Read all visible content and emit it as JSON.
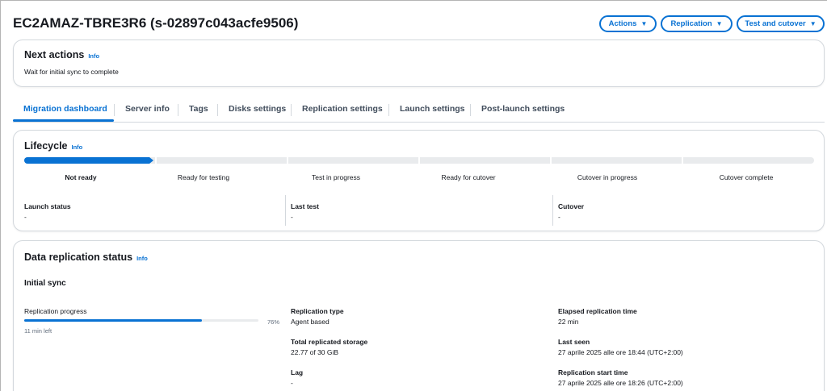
{
  "header": {
    "title": "EC2AMAZ-TBRE3R6 (s-02897c043acfe9506)",
    "actions_label": "Actions",
    "replication_label": "Replication",
    "test_cutover_label": "Test and cutover"
  },
  "next_actions": {
    "title": "Next actions",
    "info": "Info",
    "text": "Wait for initial sync to complete"
  },
  "tabs": [
    {
      "label": "Migration dashboard",
      "active": true
    },
    {
      "label": "Server info"
    },
    {
      "label": "Tags"
    },
    {
      "label": "Disks settings"
    },
    {
      "label": "Replication settings"
    },
    {
      "label": "Launch settings"
    },
    {
      "label": "Post-launch settings"
    }
  ],
  "lifecycle": {
    "title": "Lifecycle",
    "info": "Info",
    "current_stage_index": 0,
    "stages": [
      "Not ready",
      "Ready for testing",
      "Test in progress",
      "Ready for cutover",
      "Cutover in progress",
      "Cutover complete"
    ],
    "fields": [
      {
        "label": "Launch status",
        "value": "-"
      },
      {
        "label": "Last test",
        "value": "-"
      },
      {
        "label": "Cutover",
        "value": "-"
      }
    ]
  },
  "data_replication": {
    "title": "Data replication status",
    "info": "Info",
    "subtitle": "Initial sync",
    "progress_label": "Replication progress",
    "progress_percent": 76,
    "progress_text": "76%",
    "time_left": "11 min left",
    "replication_type_label": "Replication type",
    "replication_type_value": "Agent based",
    "total_storage_label": "Total replicated storage",
    "total_storage_value": "22.77 of 30 GiB",
    "lag_label": "Lag",
    "lag_value": "-",
    "elapsed_label": "Elapsed replication time",
    "elapsed_value": "22 min",
    "last_seen_label": "Last seen",
    "last_seen_value": "27 aprile 2025 alle ore 18:44 (UTC+2:00)",
    "start_time_label": "Replication start time",
    "start_time_value": "27 aprile 2025 alle ore 18:26 (UTC+2:00)"
  },
  "colors": {
    "accent": "#0972d3",
    "border": "#d3d8dd",
    "track": "#e9ebed"
  }
}
